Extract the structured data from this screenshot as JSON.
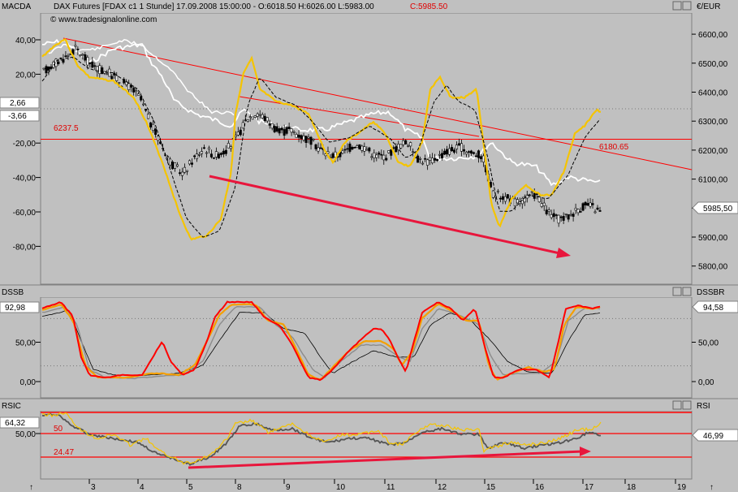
{
  "header": {
    "title": "DAX Futures [FDAX c1  1 Stunde] 17.09.2008 15:00:00 - O:6018.50 H:6026.00 L:5983.00",
    "close_text": "C:5985.50",
    "watermark": "© www.tradesignalonline.com"
  },
  "price_panel": {
    "left_label": "MACDA",
    "right_label": "€/EUR",
    "macd_marker_1": "2,66",
    "macd_marker_2": "-3,66",
    "last_price_marker": "5985,50",
    "level_1_label": "6237.5",
    "level_2_label": "6180.65"
  },
  "dssb_panel": {
    "left_label": "DSSB",
    "right_label": "DSSBR",
    "left_value": "92,98",
    "right_value": "94,58"
  },
  "rsi_panel": {
    "left_label": "RSIC",
    "right_label": "RSI",
    "left_value": "64,32",
    "right_value": "46,99",
    "level_50_label": "50",
    "level_low_label": "24.47"
  },
  "colors": {
    "background": "#c0c0c0",
    "candles": "#000000",
    "macd": "#f5c400",
    "macd_signal": "#000000",
    "band": "#ffffff",
    "trendline": "#ff0000",
    "arrow": "#e8163c",
    "dss_fast": "#ff0000",
    "dss_orange": "#f5a000",
    "dss_gray": "#8c8c8c",
    "rsi_fast": "#f5c400",
    "rsi_slow": "#555555"
  },
  "chart_data": [
    {
      "type": "candlestick",
      "x_ticks": [
        "3",
        "4",
        "5",
        "8",
        "9",
        "10",
        "11",
        "12",
        "15",
        "16",
        "17",
        "18",
        "19"
      ],
      "y_right_ticks": [
        5800,
        5900,
        6000,
        6100,
        6200,
        6300,
        6400,
        6500,
        6600
      ],
      "y_left_ticks": [
        "40,00",
        "20,00",
        "-20,00",
        "-40,00",
        "-60,00",
        "-80,00"
      ],
      "approx_close_path": [
        6470,
        6500,
        6520,
        6550,
        6510,
        6480,
        6470,
        6440,
        6420,
        6380,
        6290,
        6220,
        6150,
        6120,
        6170,
        6210,
        6180,
        6200,
        6240,
        6310,
        6330,
        6300,
        6260,
        6270,
        6250,
        6230,
        6200,
        6180,
        6190,
        6220,
        6210,
        6180,
        6180,
        6210,
        6230,
        6170,
        6160,
        6180,
        6200,
        6210,
        6190,
        6180,
        6050,
        6040,
        6020,
        6030,
        6050,
        5990,
        5960,
        5970,
        6000,
        6010,
        5985
      ],
      "horizontal_levels": [
        6237.5
      ],
      "trendline_end_value": 6180.65,
      "last_price": 5985.5
    },
    {
      "type": "line",
      "name": "DSSB",
      "y_ticks": [
        "50,00",
        "0,00"
      ],
      "series_hint": "double smoothed stochastic oscillator, 0-100"
    },
    {
      "type": "line",
      "name": "RSIC",
      "y_ticks": [
        "50,00"
      ],
      "levels": [
        50,
        24.47
      ]
    }
  ]
}
